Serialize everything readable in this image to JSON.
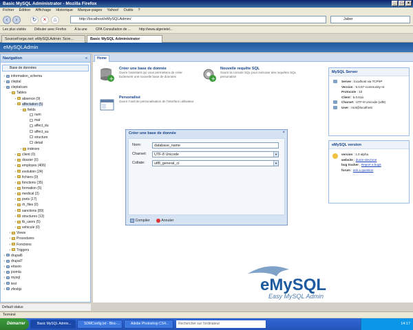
{
  "window": {
    "title": "Basic MySQL Administrator - Mozilla Firefox"
  },
  "menu": [
    "Fichier",
    "Édition",
    "Affichage",
    "Historique",
    "Marque-pages",
    "Yahoo!",
    "Outils",
    "?"
  ],
  "nav": {
    "url": "http://localhost/eMySQLAdmin/",
    "search_text": "Jaber"
  },
  "bookmarks": [
    "Les plus visités",
    "Débuter avec Firefox",
    "À la une",
    "CPA Consultation de ...",
    "http://www.algerietel..."
  ],
  "tabs": [
    "SourceForge.net: eMySQLAdmin: Scre...",
    "Basic MySQL Administrator"
  ],
  "app": {
    "name": "eMySQLAdmin"
  },
  "left": {
    "title": "Navigation",
    "db_select": "Base de données",
    "tree": [
      {
        "label": "information_schema",
        "x": 4,
        "type": "db",
        "tg": "+"
      },
      {
        "label": "cleptal",
        "x": 4,
        "type": "db",
        "tg": "+"
      },
      {
        "label": "cleptalcars",
        "x": 4,
        "type": "db",
        "tg": "−"
      },
      {
        "label": "Tables",
        "x": 12,
        "type": "folder",
        "tg": "−"
      },
      {
        "label": "absence (9)",
        "x": 20,
        "type": "folder",
        "tg": "+"
      },
      {
        "label": "affectation (5)",
        "x": 20,
        "type": "folder",
        "tg": "−",
        "sel": true
      },
      {
        "label": "fields",
        "x": 28,
        "type": "folder",
        "tg": "−"
      },
      {
        "label": "num",
        "x": 38,
        "type": "leaf",
        "tg": ""
      },
      {
        "label": "mat",
        "x": 38,
        "type": "leaf",
        "tg": ""
      },
      {
        "label": "affect_du",
        "x": 38,
        "type": "leaf",
        "tg": ""
      },
      {
        "label": "affect_au",
        "x": 38,
        "type": "leaf",
        "tg": ""
      },
      {
        "label": "structure",
        "x": 38,
        "type": "leaf",
        "tg": ""
      },
      {
        "label": "detail",
        "x": 38,
        "type": "leaf",
        "tg": ""
      },
      {
        "label": "indexes",
        "x": 28,
        "type": "folder",
        "tg": "+"
      },
      {
        "label": "client (0)",
        "x": 20,
        "type": "folder",
        "tg": "+"
      },
      {
        "label": "dossier (0)",
        "x": 20,
        "type": "folder",
        "tg": "+"
      },
      {
        "label": "employes (406)",
        "x": 20,
        "type": "folder",
        "tg": "+"
      },
      {
        "label": "evolution (24)",
        "x": 20,
        "type": "folder",
        "tg": "+"
      },
      {
        "label": "fichiers (0)",
        "x": 20,
        "type": "folder",
        "tg": "+"
      },
      {
        "label": "fonctions (35)",
        "x": 20,
        "type": "folder",
        "tg": "+"
      },
      {
        "label": "formation (5)",
        "x": 20,
        "type": "folder",
        "tg": "+"
      },
      {
        "label": "medical (3)",
        "x": 20,
        "type": "folder",
        "tg": "+"
      },
      {
        "label": "prets (17)",
        "x": 20,
        "type": "folder",
        "tg": "+"
      },
      {
        "label": "rh_files (0)",
        "x": 20,
        "type": "folder",
        "tg": "+"
      },
      {
        "label": "sanctions (89)",
        "x": 20,
        "type": "folder",
        "tg": "+"
      },
      {
        "label": "structures (13)",
        "x": 20,
        "type": "folder",
        "tg": "+"
      },
      {
        "label": "tb_users (5)",
        "x": 20,
        "type": "folder",
        "tg": "+"
      },
      {
        "label": "vehicule (0)",
        "x": 20,
        "type": "folder",
        "tg": "+"
      },
      {
        "label": "Views",
        "x": 12,
        "type": "folder",
        "tg": "+"
      },
      {
        "label": "Procedures",
        "x": 12,
        "type": "folder",
        "tg": "+"
      },
      {
        "label": "Fonctions",
        "x": 12,
        "type": "folder",
        "tg": "+"
      },
      {
        "label": "Triggers",
        "x": 12,
        "type": "folder",
        "tg": "+"
      },
      {
        "label": "drupal6",
        "x": 4,
        "type": "db",
        "tg": "+"
      },
      {
        "label": "drupal7",
        "x": 4,
        "type": "db",
        "tg": "+"
      },
      {
        "label": "elraxio",
        "x": 4,
        "type": "db",
        "tg": "+"
      },
      {
        "label": "joomla",
        "x": 4,
        "type": "db",
        "tg": "+"
      },
      {
        "label": "mysql",
        "x": 4,
        "type": "db",
        "tg": "+"
      },
      {
        "label": "test",
        "x": 4,
        "type": "db",
        "tg": "+"
      },
      {
        "label": "zfevbjs",
        "x": 4,
        "type": "db",
        "tg": "+"
      }
    ],
    "status": "Default status"
  },
  "home": {
    "tab": "Home",
    "cards": [
      {
        "title": "Créer une base de donnée",
        "desc": "Ouvre l'assistant qui vous permettera de créer facilement une nouvelle base de données"
      },
      {
        "title": "Nouvelle requête SQL",
        "desc": "Ouvre la console SQL pour exécuter des requêtes SQL personalisé"
      },
      {
        "title": "Personalisé",
        "desc": "Ouvre l'outil de personalisation de l'interface utilisateur"
      }
    ]
  },
  "server": {
    "title": "MySQL Server",
    "rows": [
      {
        "k": "Server",
        "v": "localhost via TCP/IP"
      },
      {
        "k": "Version",
        "v": "5.0.67-community-nt"
      },
      {
        "k": "Protocole",
        "v": "10"
      },
      {
        "k": "Client",
        "v": "5.0.51a"
      },
      {
        "k": "Charset",
        "v": "UTF-8 Unicode (utf8)"
      },
      {
        "k": "User",
        "v": "root@localhost"
      }
    ]
  },
  "emysql": {
    "title": "eMySQL version",
    "version_k": "version",
    "version_v": "1.0 alpha",
    "website_k": "website",
    "website_v": "duore-devzone",
    "bug_k": "bug tracker",
    "bug_v": "Report a bugs",
    "forum_k": "forum",
    "forum_v": "ask a question"
  },
  "dialog": {
    "title": "Créer une base de donnée",
    "nom_label": "Nom:",
    "nom_value": "database_name",
    "charset_label": "Charset:",
    "charset_value": "UTF-8 Unicode",
    "collate_label": "Collate:",
    "collate_value": "utf8_general_ci",
    "submit": "Compiler",
    "cancel": "Annuler"
  },
  "logo": {
    "brand": "eMySQL",
    "tagline": "Easy MySQL Admin"
  },
  "statusbar": "Terminé",
  "taskbar": {
    "start": "Démarrer",
    "items": [
      "Basic MySQL Admin...",
      "SDMConfig.txt - Bloc-...",
      "Adobe Photoshop CS4..."
    ],
    "search_placeholder": "Rechercher sur l'ordinateur",
    "time": "14:17"
  }
}
